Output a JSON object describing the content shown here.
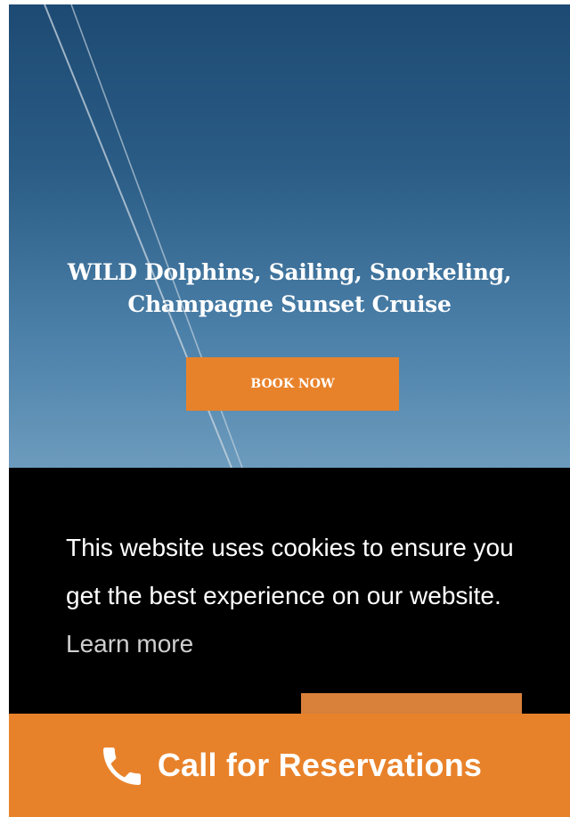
{
  "hero": {
    "title_line1": "WILD Dolphins, Sailing, Snorkeling,",
    "title_line2": "Champagne Sunset Cruise",
    "book_button_label": "BOOK NOW"
  },
  "cookie_banner": {
    "message": "This website uses cookies to ensure you get the best experience on our website.",
    "learn_more_label": "Learn more",
    "accept_button_label": ""
  },
  "call_bar": {
    "label": "Call for Reservations",
    "icon": "phone-icon"
  },
  "colors": {
    "accent": "#e8822a",
    "banner_background": "#000000",
    "sky_top": "#1d4a73",
    "sky_bottom": "#6c9bbd"
  }
}
